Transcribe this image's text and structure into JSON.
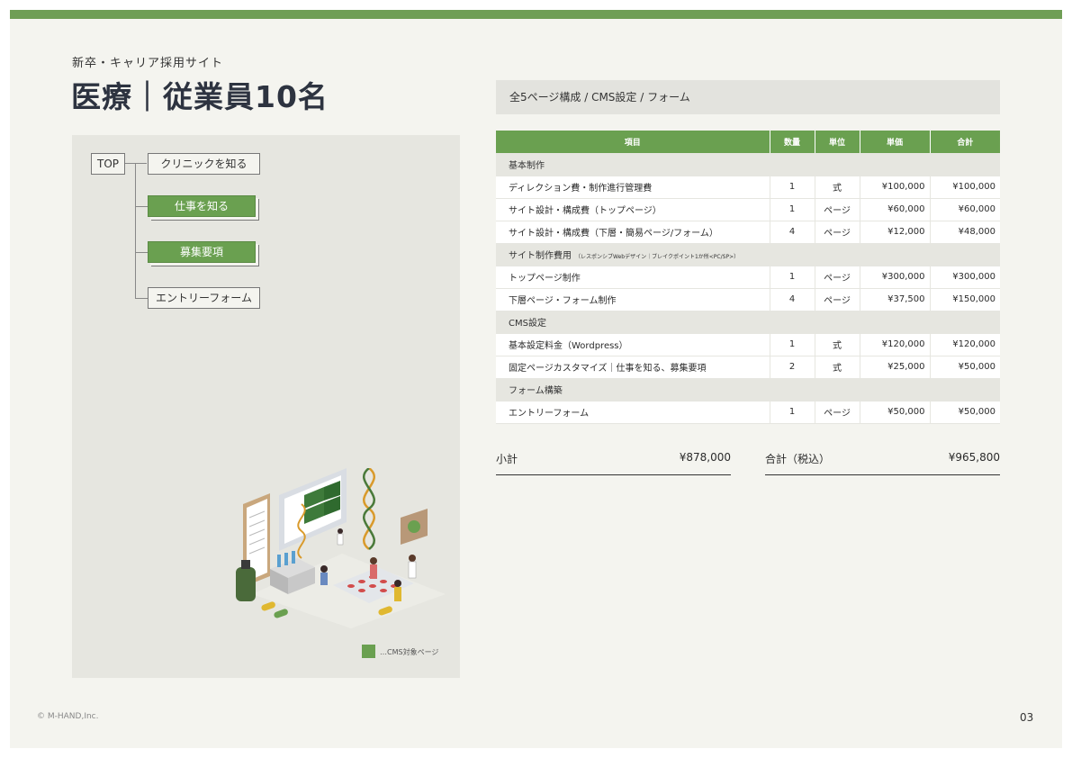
{
  "header": {
    "subtitle": "新卒・キャリア採用サイト",
    "title": "医療｜従業員10名"
  },
  "sitemap": {
    "root": "TOP",
    "children": [
      {
        "label": "クリニックを知る",
        "cms": false
      },
      {
        "label": "仕事を知る",
        "cms": true
      },
      {
        "label": "募集要項",
        "cms": true
      },
      {
        "label": "エントリーフォーム",
        "cms": false
      }
    ],
    "legend": "…CMS対象ページ"
  },
  "scope": "全5ページ構成 / CMS設定 / フォーム",
  "table": {
    "headers": [
      "項目",
      "数量",
      "単位",
      "単価",
      "合計"
    ],
    "sections": [
      {
        "title": "基本制作",
        "note": "",
        "rows": [
          {
            "item": "ディレクション費・制作進行管理費",
            "qty": "1",
            "unit": "式",
            "price": "¥100,000",
            "total": "¥100,000"
          },
          {
            "item": "サイト設計・構成費（トップページ）",
            "qty": "1",
            "unit": "ページ",
            "price": "¥60,000",
            "total": "¥60,000"
          },
          {
            "item": "サイト設計・構成費（下層・簡易ページ/フォーム）",
            "qty": "4",
            "unit": "ページ",
            "price": "¥12,000",
            "total": "¥48,000"
          }
        ]
      },
      {
        "title": "サイト制作費用",
        "note": "（レスポンシブWebデザイン｜ブレイクポイント1か所<PC/SP>）",
        "rows": [
          {
            "item": "トップページ制作",
            "qty": "1",
            "unit": "ページ",
            "price": "¥300,000",
            "total": "¥300,000"
          },
          {
            "item": "下層ページ・フォーム制作",
            "qty": "4",
            "unit": "ページ",
            "price": "¥37,500",
            "total": "¥150,000"
          }
        ]
      },
      {
        "title": "CMS設定",
        "note": "",
        "rows": [
          {
            "item": "基本設定料金（Wordpress）",
            "qty": "1",
            "unit": "式",
            "price": "¥120,000",
            "total": "¥120,000"
          },
          {
            "item": "固定ページカスタマイズ｜仕事を知る、募集要項",
            "qty": "2",
            "unit": "式",
            "price": "¥25,000",
            "total": "¥50,000"
          }
        ]
      },
      {
        "title": "フォーム構築",
        "note": "",
        "rows": [
          {
            "item": "エントリーフォーム",
            "qty": "1",
            "unit": "ページ",
            "price": "¥50,000",
            "total": "¥50,000"
          }
        ]
      }
    ]
  },
  "totals": {
    "subtotal_label": "小計",
    "subtotal_value": "¥878,000",
    "total_label": "合計（税込）",
    "total_value": "¥965,800"
  },
  "footer": {
    "copyright": "© M-HAND,Inc.",
    "page": "03"
  },
  "colors": {
    "accent": "#6aa050",
    "panel": "#e6e6e0",
    "background": "#f4f4ef"
  }
}
